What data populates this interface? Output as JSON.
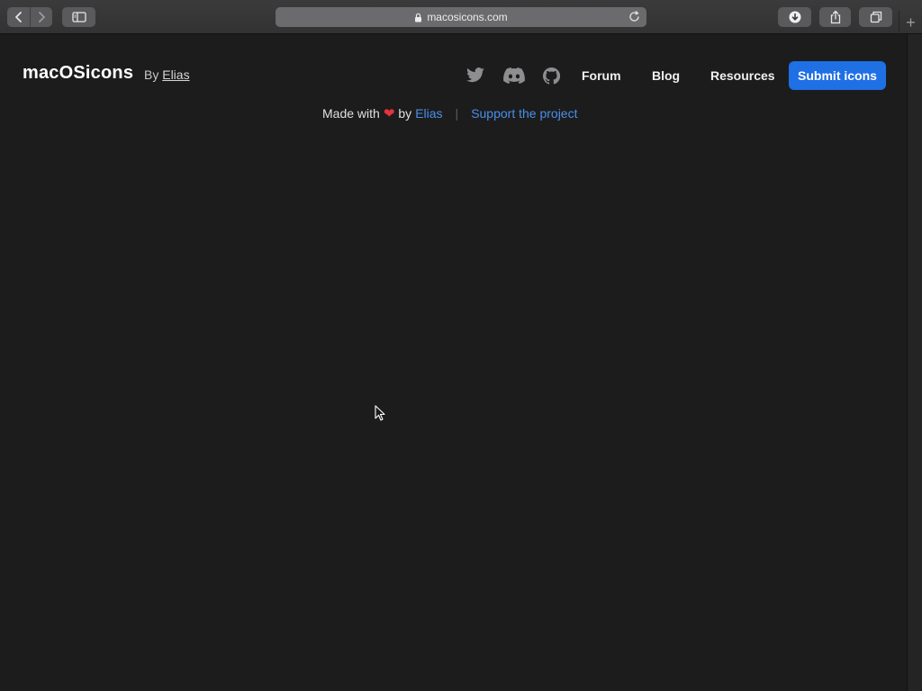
{
  "browser": {
    "url": "macosicons.com",
    "new_tab_symbol": "+",
    "icons": {
      "back": "chevron-left-icon",
      "forward": "chevron-right-icon",
      "sidebar": "sidebar-icon",
      "lock": "lock-icon",
      "reload": "reload-icon",
      "download": "download-icon",
      "share": "share-icon",
      "tabs": "tabs-overview-icon"
    }
  },
  "header": {
    "logo": "macOSicons",
    "by_label": "By",
    "author": "Elias",
    "social": [
      "twitter-icon",
      "discord-icon",
      "github-icon"
    ],
    "nav": {
      "forum": "Forum",
      "blog": "Blog",
      "resources": "Resources"
    },
    "submit_label": "Submit icons"
  },
  "tagline": {
    "made_with": "Made with",
    "heart": "❤",
    "by": "by",
    "author": "Elias",
    "separator": "|",
    "support": "Support the project"
  },
  "colors": {
    "background": "#1c1c1d",
    "accent": "#1f6fe5",
    "link": "#4a8fe8",
    "heart": "#e8323b"
  }
}
